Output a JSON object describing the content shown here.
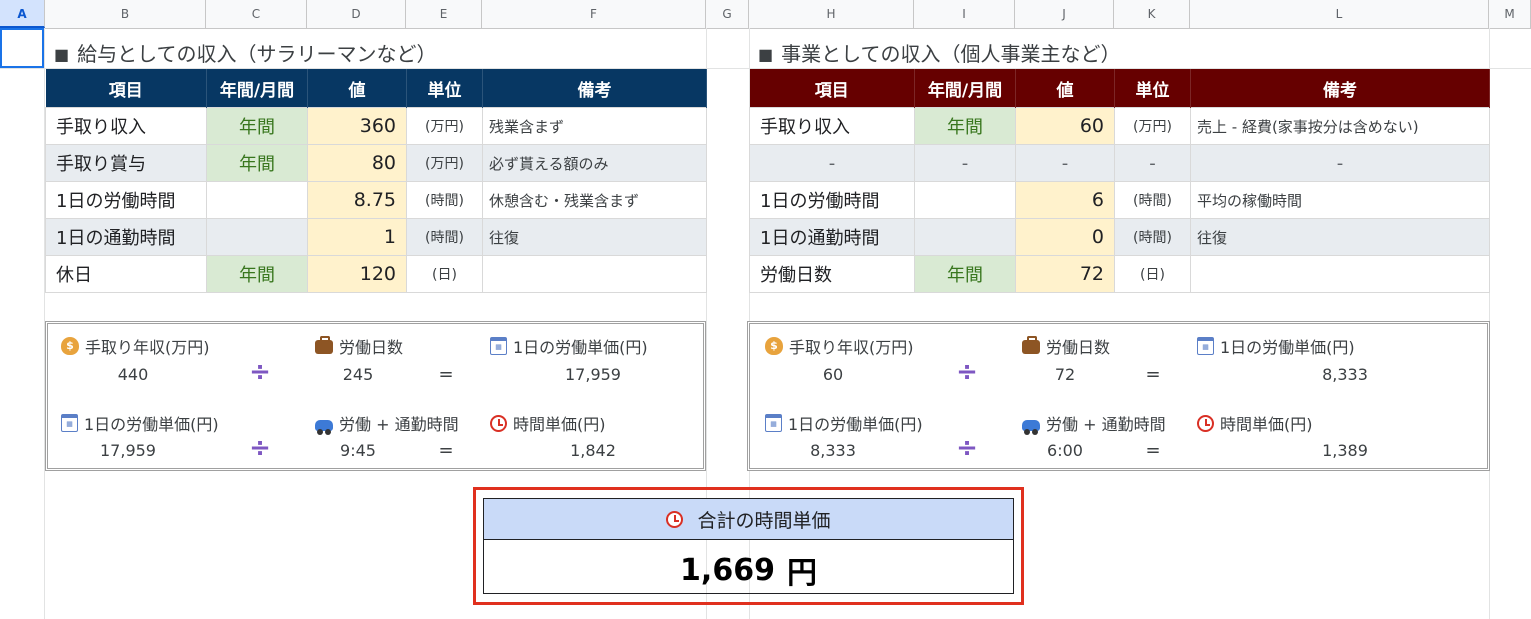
{
  "sheet": {
    "columns": [
      "A",
      "B",
      "C",
      "D",
      "E",
      "F",
      "G",
      "H",
      "I",
      "J",
      "K",
      "L",
      "M"
    ],
    "selected_column": "A"
  },
  "left": {
    "title": "給与としての収入（サラリーマンなど）",
    "headers": [
      "項目",
      "年間/月間",
      "値",
      "単位",
      "備考"
    ],
    "rows": [
      {
        "item": "手取り収入",
        "period": "年間",
        "value": "360",
        "unit": "(万円)",
        "note": "残業含まず"
      },
      {
        "item": "手取り賞与",
        "period": "年間",
        "value": "80",
        "unit": "(万円)",
        "note": "必ず貰える額のみ"
      },
      {
        "item": "1日の労働時間",
        "period": "",
        "value": "8.75",
        "unit": "(時間)",
        "note": "休憩含む・残業含まず"
      },
      {
        "item": "1日の通勤時間",
        "period": "",
        "value": "1",
        "unit": "(時間)",
        "note": "往復"
      },
      {
        "item": "休日",
        "period": "年間",
        "value": "120",
        "unit": "(日)",
        "note": ""
      }
    ],
    "calc": {
      "row1": {
        "label_a": "手取り年収(万円)",
        "label_b": "労働日数",
        "label_c": "1日の労働単価(円)",
        "val_a": "440",
        "op1": "÷",
        "val_b": "245",
        "op2": "=",
        "val_c": "17,959"
      },
      "row2": {
        "label_a": "1日の労働単価(円)",
        "label_b": "労働 + 通勤時間",
        "label_c": "時間単価(円)",
        "val_a": "17,959",
        "op1": "÷",
        "val_b": "9:45",
        "op2": "=",
        "val_c": "1,842"
      }
    }
  },
  "right": {
    "title": "事業としての収入（個人事業主など）",
    "headers": [
      "項目",
      "年間/月間",
      "値",
      "単位",
      "備考"
    ],
    "rows": [
      {
        "item": "手取り収入",
        "period": "年間",
        "value": "60",
        "unit": "(万円)",
        "note": "売上 - 経費(家事按分は含めない)"
      },
      {
        "item": "-",
        "period": "-",
        "value": "-",
        "unit": "-",
        "note": "-"
      },
      {
        "item": "1日の労働時間",
        "period": "",
        "value": "6",
        "unit": "(時間)",
        "note": "平均の稼働時間"
      },
      {
        "item": "1日の通勤時間",
        "period": "",
        "value": "0",
        "unit": "(時間)",
        "note": "往復"
      },
      {
        "item": "労働日数",
        "period": "年間",
        "value": "72",
        "unit": "(日)",
        "note": ""
      }
    ],
    "calc": {
      "row1": {
        "label_a": "手取り年収(万円)",
        "label_b": "労働日数",
        "label_c": "1日の労働単価(円)",
        "val_a": "60",
        "op1": "÷",
        "val_b": "72",
        "op2": "=",
        "val_c": "8,333"
      },
      "row2": {
        "label_a": "1日の労働単価(円)",
        "label_b": "労働 + 通勤時間",
        "label_c": "時間単価(円)",
        "val_a": "8,333",
        "op1": "÷",
        "val_b": "6:00",
        "op2": "=",
        "val_c": "1,389"
      }
    }
  },
  "total": {
    "title": "合計の時間単価",
    "value": "1,669",
    "unit": "円"
  },
  "icons": {
    "money_bag": "money-bag-icon",
    "briefcase": "briefcase-icon",
    "calendar": "calendar-icon",
    "car": "car-icon",
    "alarm_clock": "alarm-clock-icon"
  },
  "colors": {
    "left_header": "#073763",
    "right_header": "#660000",
    "period_fill": "#d9ead3",
    "value_fill": "#fff2cc",
    "total_border": "#e0301e",
    "total_head": "#c9daf8"
  }
}
